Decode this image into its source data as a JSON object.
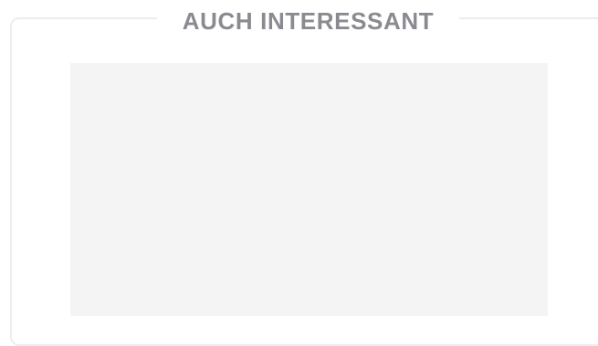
{
  "section": {
    "heading": "AUCH INTERESSANT"
  }
}
